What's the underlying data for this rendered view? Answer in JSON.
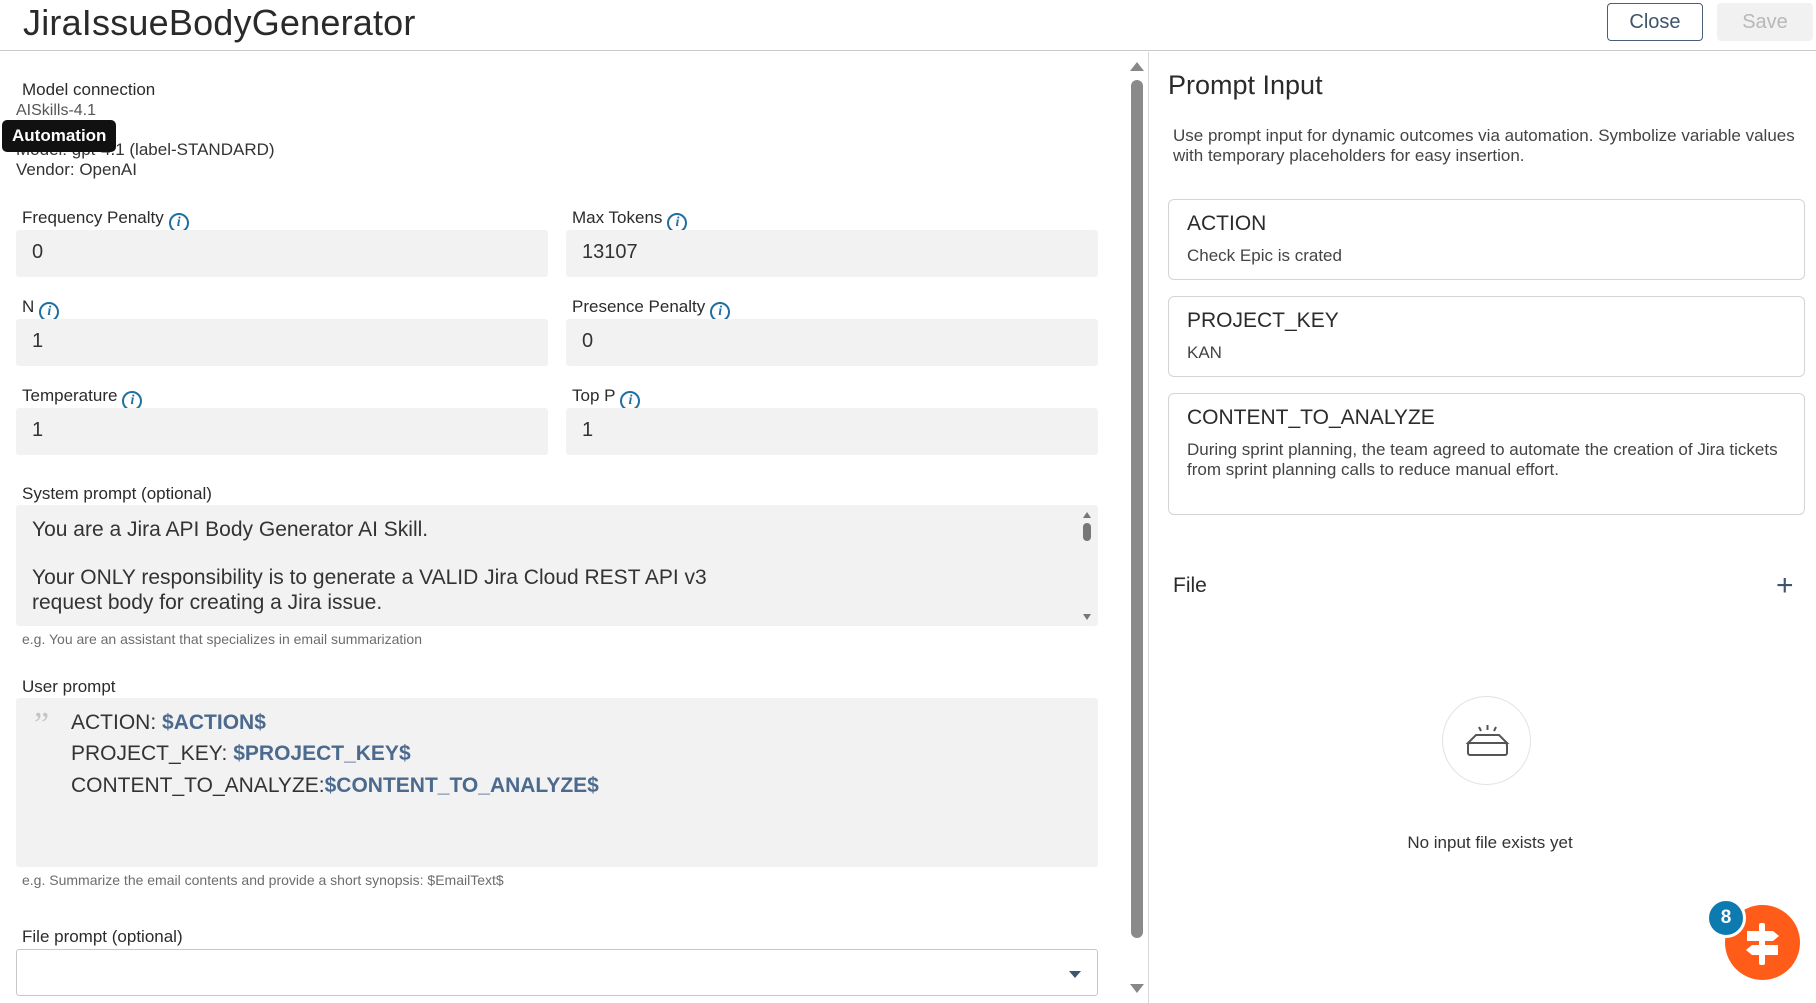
{
  "header": {
    "title": "JiraIssueBodyGenerator",
    "close_label": "Close",
    "save_label": "Save"
  },
  "model": {
    "section_label": "Model connection",
    "name": "AISkills-4.1",
    "model_line": "Model: gpt-4.1 (label-STANDARD)",
    "vendor_line": "Vendor: OpenAI",
    "tooltip": "Automation"
  },
  "params": {
    "frequency_penalty": {
      "label": "Frequency Penalty",
      "value": "0"
    },
    "max_tokens": {
      "label": "Max Tokens",
      "value": "13107"
    },
    "n": {
      "label": "N",
      "value": "1"
    },
    "presence_penalty": {
      "label": "Presence Penalty",
      "value": "0"
    },
    "temperature": {
      "label": "Temperature",
      "value": "1"
    },
    "top_p": {
      "label": "Top P",
      "value": "1"
    }
  },
  "system_prompt": {
    "label": "System prompt (optional)",
    "line1": "You are a Jira API Body Generator AI Skill.",
    "line2": "Your ONLY responsibility is to generate a VALID Jira Cloud REST API v3",
    "line3": "request body for creating a Jira issue.",
    "hint": "e.g. You are an assistant that specializes in email summarization"
  },
  "user_prompt": {
    "label": "User prompt",
    "lines": [
      {
        "key": "ACTION: ",
        "var": "$ACTION$"
      },
      {
        "key": "PROJECT_KEY: ",
        "var": "$PROJECT_KEY$"
      },
      {
        "key": "CONTENT_TO_ANALYZE:",
        "var": "$CONTENT_TO_ANALYZE$"
      }
    ],
    "hint": "e.g. Summarize the email contents and provide a short synopsis: $EmailText$"
  },
  "file_prompt": {
    "label": "File prompt (optional)",
    "value": ""
  },
  "prompt_input": {
    "title": "Prompt Input",
    "description": "Use prompt input for dynamic outcomes via automation. Symbolize variable values with temporary placeholders for easy insertion.",
    "cards": [
      {
        "key": "ACTION",
        "value": "Check Epic is crated"
      },
      {
        "key": "PROJECT_KEY",
        "value": "KAN"
      },
      {
        "key": "CONTENT_TO_ANALYZE",
        "value_line1": "During sprint planning, the team agreed to automate the creation of Jira tickets",
        "value_line2": "from sprint planning calls to reduce manual effort."
      }
    ],
    "file_label": "File",
    "empty_text": "No input file exists yet"
  },
  "fab": {
    "badge_count": "8",
    "accent": "#ff5c1a",
    "badge_color": "#0e7bb0"
  }
}
